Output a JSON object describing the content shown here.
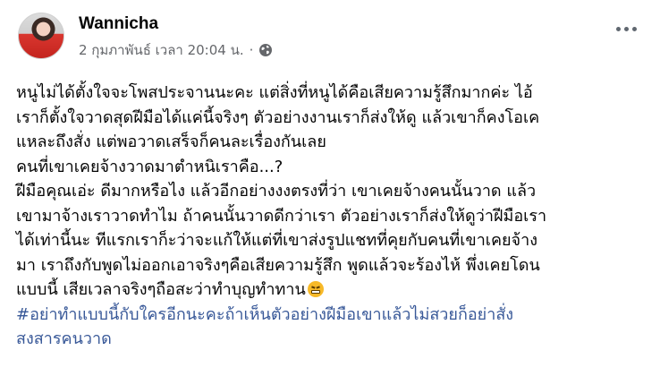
{
  "post": {
    "author": "Wannicha",
    "timestamp": "2 กุมภาพันธ์ เวลา 20:04 น.",
    "separator": "·",
    "privacy_icon": "globe-icon",
    "menu_icon": "more-options-icon",
    "body_lines": [
      "หนูไม่ได้ตั้งใจจะโพสประจานนะคะ แต่สิ่งที่หนูได้คือเสียความรู้สึกมากค่ะ ไอ้",
      "เราก็ตั้งใจวาดสุดฝีมือได้แค่นี้จริงๆ ตัวอย่างงานเราก็ส่งให้ดู แล้วเขาก็คงโอเค",
      "แหละถึงสั่ง แต่พอวาดเสร็จก็คนละเรื่องกันเลย",
      "คนที่เขาเคยจ้างวาดมาตำหนิเราคือ...?",
      "ฝีมือคุณเอ่ะ ดีมากหรือไง แล้วอีกอย่างงงตรงที่ว่า เขาเคยจ้างคนนั้นวาด แล้ว",
      "เขามาจ้างเราวาดทำไม ถ้าคนนั้นวาดดีกว่าเรา ตัวอย่างเราก็ส่งให้ดูว่าฝีมือเรา",
      "ได้เท่านี้นะ ทีแรกเราก็ะว่าจะแก้ให้แต่ที่เขาส่งรูปแชทที่คุยกับคนที่เขาเคยจ้าง",
      "มา เราถึงกับพูดไม่ออกเอาจริงๆคือเสียความรู้สึก พูดแล้วจะร้องไห้ พึ่งเคยโดน",
      "แบบนี้ เสียเวลาจริงๆถือสะว่าทำบุญทำทาน"
    ],
    "emoji": "grimacing-face-emoji",
    "hashtag_lines": [
      "#อย่าทำแบบนี้กับใครอีกนะคะถ้าเห็นตัวอย่างฝีมือเขาแล้วไม่สวยก็อย่าสั่ง",
      "สงสารคนวาด"
    ],
    "colors": {
      "text": "#050505",
      "secondary": "#65676b",
      "hashtag": "#385898"
    }
  }
}
